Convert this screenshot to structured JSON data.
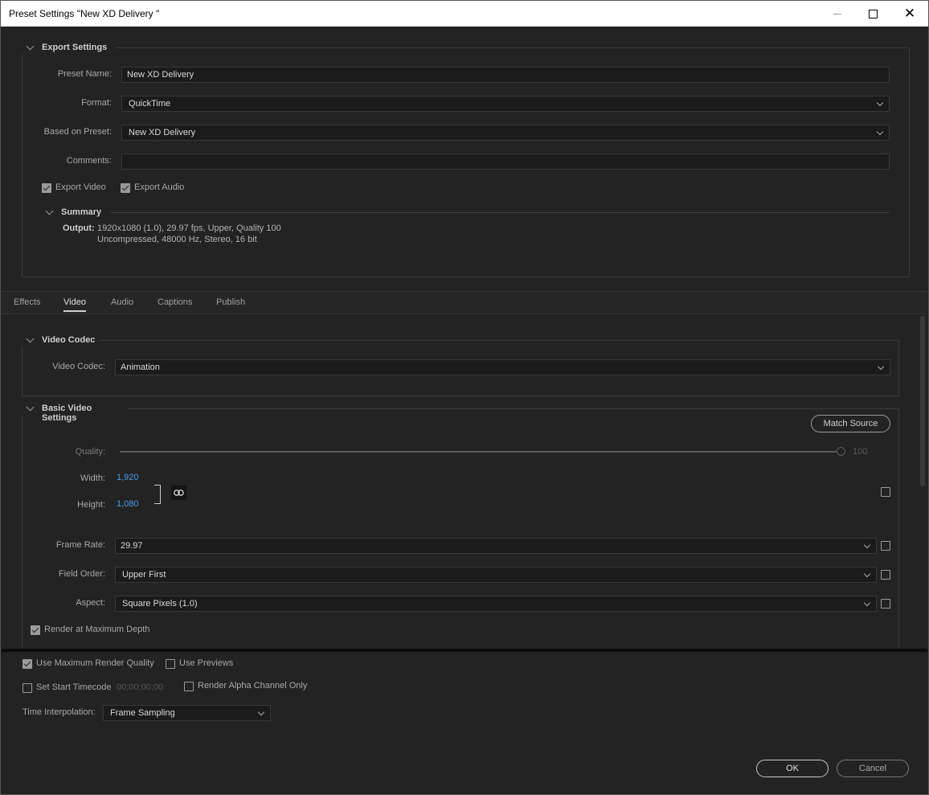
{
  "window": {
    "title": "Preset Settings \"New XD Delivery \""
  },
  "export_settings": {
    "title": "Export Settings",
    "preset_name_label": "Preset Name:",
    "preset_name_value": "New XD Delivery",
    "format_label": "Format:",
    "format_value": "QuickTime",
    "based_on_label": "Based on Preset:",
    "based_on_value": "New XD Delivery",
    "comments_label": "Comments:",
    "comments_value": "",
    "export_video_label": "Export Video",
    "export_video_checked": true,
    "export_audio_label": "Export Audio",
    "export_audio_checked": true,
    "summary": {
      "title": "Summary",
      "output_label": "Output:",
      "output_line1": "1920x1080 (1.0), 29.97 fps, Upper, Quality 100",
      "output_line2": "Uncompressed, 48000 Hz, Stereo, 16 bit"
    }
  },
  "tabs": [
    {
      "label": "Effects",
      "active": false
    },
    {
      "label": "Video",
      "active": true
    },
    {
      "label": "Audio",
      "active": false
    },
    {
      "label": "Captions",
      "active": false
    },
    {
      "label": "Publish",
      "active": false
    }
  ],
  "video_codec": {
    "title": "Video Codec",
    "codec_label": "Video Codec:",
    "codec_value": "Animation"
  },
  "basic_video": {
    "title": "Basic Video Settings",
    "match_source_label": "Match Source",
    "quality_label": "Quality:",
    "quality_value": "100",
    "quality_fraction": 1.0,
    "width_label": "Width:",
    "width_value": "1,920",
    "height_label": "Height:",
    "height_value": "1,080",
    "frame_rate_label": "Frame Rate:",
    "frame_rate_value": "29.97",
    "field_order_label": "Field Order:",
    "field_order_value": "Upper First",
    "aspect_label": "Aspect:",
    "aspect_value": "Square Pixels (1.0)",
    "render_max_depth_label": "Render at Maximum Depth",
    "render_max_depth_checked": true
  },
  "footer": {
    "use_max_quality_label": "Use Maximum Render Quality",
    "use_max_quality_checked": true,
    "use_previews_label": "Use Previews",
    "use_previews_checked": false,
    "set_start_tc_label": "Set Start Timecode",
    "set_start_tc_checked": false,
    "start_tc_value": "00;00;00;00",
    "render_alpha_label": "Render Alpha Channel Only",
    "render_alpha_checked": false,
    "time_interp_label": "Time Interpolation:",
    "time_interp_value": "Frame Sampling",
    "ok_label": "OK",
    "cancel_label": "Cancel"
  }
}
